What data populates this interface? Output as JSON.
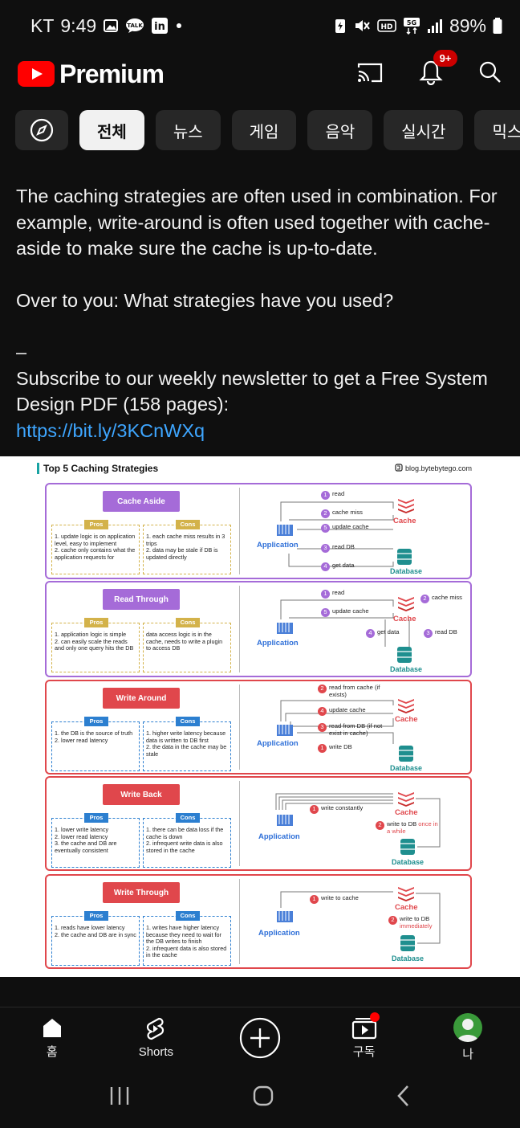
{
  "status_bar": {
    "carrier": "KT",
    "time": "9:49",
    "battery": "89%",
    "network": "5G"
  },
  "header": {
    "brand": "Premium",
    "notification_badge": "9+"
  },
  "chips": [
    {
      "label": "전체",
      "active": true
    },
    {
      "label": "뉴스",
      "active": false
    },
    {
      "label": "게임",
      "active": false
    },
    {
      "label": "음악",
      "active": false
    },
    {
      "label": "실시간",
      "active": false
    },
    {
      "label": "믹스",
      "active": false
    }
  ],
  "post": {
    "paragraph1": "The caching strategies are often used in combination. For example, write-around is often used together with cache-aside to make sure the cache is up-to-date.",
    "paragraph2": "Over to you: What strategies have you used?",
    "separator": "–",
    "paragraph3": "Subscribe to our weekly newsletter to get a Free System Design PDF (158 pages):",
    "link": "https://bit.ly/3KCnWXq"
  },
  "infographic": {
    "title": "Top 5 Caching Strategies",
    "site": "blog.bytebytego.com",
    "pros_label": "Pros",
    "cons_label": "Cons",
    "app_label": "Application",
    "cache_label": "Cache",
    "db_label": "Database",
    "panels": [
      {
        "title": "Cache Aside",
        "pros": [
          "1. update logic is on application level, easy to implement",
          "2. cache only contains what the application requests for"
        ],
        "cons": [
          "1. each cache miss results in 3 trips",
          "2. data may be stale if DB is updated directly"
        ],
        "steps": [
          {
            "n": "1",
            "text": "read"
          },
          {
            "n": "2",
            "text": "cache miss"
          },
          {
            "n": "5",
            "text": "update cache"
          },
          {
            "n": "3",
            "text": "read DB"
          },
          {
            "n": "4",
            "text": "get data"
          }
        ]
      },
      {
        "title": "Read Through",
        "pros": [
          "1. application logic is simple",
          "2. can easily scale the reads and only one query hits the DB"
        ],
        "cons": [
          "data access logic is in the cache, needs to write a plugin to access DB"
        ],
        "steps": [
          {
            "n": "1",
            "text": "read"
          },
          {
            "n": "2",
            "text": "cache miss"
          },
          {
            "n": "5",
            "text": "update cache"
          },
          {
            "n": "4",
            "text": "get data"
          },
          {
            "n": "3",
            "text": "read DB"
          }
        ]
      },
      {
        "title": "Write Around",
        "pros": [
          "1. the DB is the source of truth",
          "2. lower read latency"
        ],
        "cons": [
          "1. higher write latency because data is written to DB first",
          "2. the data in the cache may be stale"
        ],
        "steps": [
          {
            "n": "2",
            "text": "read from cache (if exists)"
          },
          {
            "n": "4",
            "text": "update cache"
          },
          {
            "n": "3",
            "text": "read from DB (if not exist in cache)"
          },
          {
            "n": "1",
            "text": "write DB"
          }
        ]
      },
      {
        "title": "Write Back",
        "pros": [
          "1. lower write latency",
          "2. lower read latency",
          "3. the cache and DB are eventually consistent"
        ],
        "cons": [
          "1. there can be data loss if the cache is down",
          "2. infrequent write data is also stored in the cache"
        ],
        "steps": [
          {
            "n": "1",
            "text": "write constantly"
          },
          {
            "n": "2",
            "text": "write to DB",
            "extra": "once in a while"
          }
        ]
      },
      {
        "title": "Write Through",
        "pros": [
          "1. reads have lower latency",
          "2. the cache and DB are in sync"
        ],
        "cons": [
          "1. writes have higher latency because they need to wait for the DB writes to finish",
          "2. infrequent data is also stored in the cache"
        ],
        "steps": [
          {
            "n": "1",
            "text": "write to cache"
          },
          {
            "n": "2",
            "text": "write to DB",
            "extra": "immediately"
          }
        ]
      }
    ]
  },
  "bottom_nav": [
    {
      "label": "홈"
    },
    {
      "label": "Shorts"
    },
    {
      "label": ""
    },
    {
      "label": "구독"
    },
    {
      "label": "나"
    }
  ],
  "colors": {
    "background": "#0f0f0f",
    "youtube_red": "#ff0000",
    "link": "#3ea6ff",
    "chip": "#272727",
    "purple_panel": "#a56bd8",
    "red_panel": "#e0474c"
  }
}
